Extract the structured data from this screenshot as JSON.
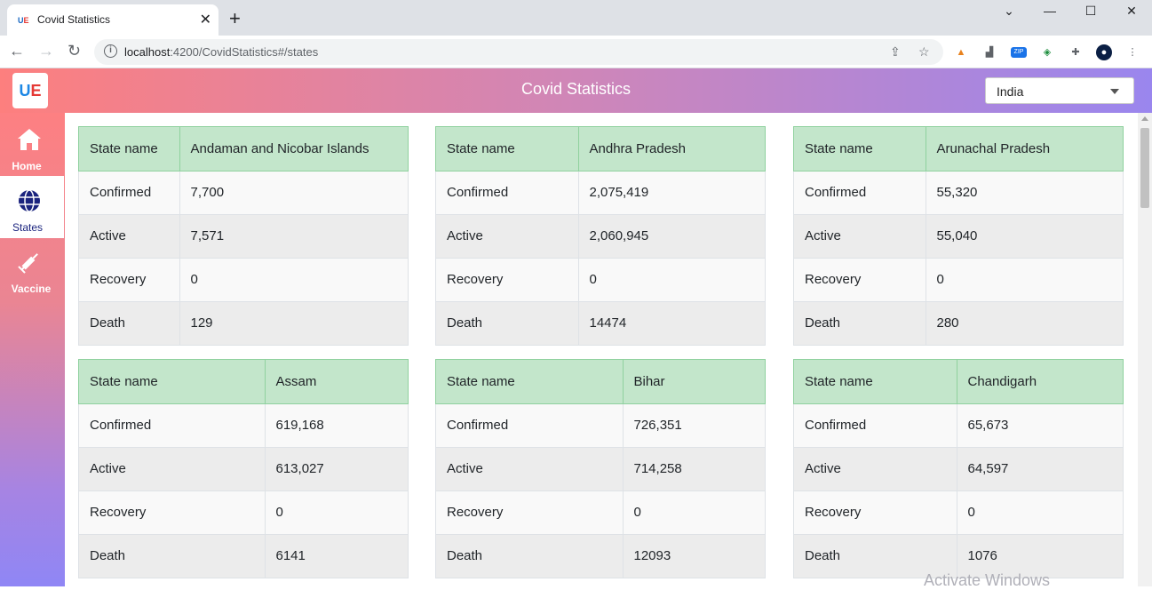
{
  "browser": {
    "tab_title": "Covid Statistics",
    "tab_favicon_a": "U",
    "tab_favicon_b": "E",
    "url_host": "localhost",
    "url_path": ":4200/CovidStatistics#/states"
  },
  "app": {
    "logo_a": "U",
    "logo_b": "E",
    "title": "Covid Statistics",
    "country": "India"
  },
  "sidebar": {
    "items": [
      {
        "label": "Home",
        "icon": "home-icon"
      },
      {
        "label": "States",
        "icon": "globe-icon"
      },
      {
        "label": "Vaccine",
        "icon": "syringe-icon"
      }
    ]
  },
  "row_labels": {
    "state": "State name",
    "confirmed": "Confirmed",
    "active": "Active",
    "recovery": "Recovery",
    "death": "Death"
  },
  "states": [
    {
      "name": "Andaman and Nicobar Islands",
      "confirmed": "7,700",
      "active": "7,571",
      "recovery": "0",
      "death": "129"
    },
    {
      "name": "Andhra Pradesh",
      "confirmed": "2,075,419",
      "active": "2,060,945",
      "recovery": "0",
      "death": "14474"
    },
    {
      "name": "Arunachal Pradesh",
      "confirmed": "55,320",
      "active": "55,040",
      "recovery": "0",
      "death": "280"
    },
    {
      "name": "Assam",
      "confirmed": "619,168",
      "active": "613,027",
      "recovery": "0",
      "death": "6141"
    },
    {
      "name": "Bihar",
      "confirmed": "726,351",
      "active": "714,258",
      "recovery": "0",
      "death": "12093"
    },
    {
      "name": "Chandigarh",
      "confirmed": "65,673",
      "active": "64,597",
      "recovery": "0",
      "death": "1076"
    }
  ],
  "watermark": "Activate Windows",
  "colors": {
    "header_start": "#fd7f7e",
    "header_end": "#9a86ee",
    "table_head": "#c3e6cb"
  }
}
